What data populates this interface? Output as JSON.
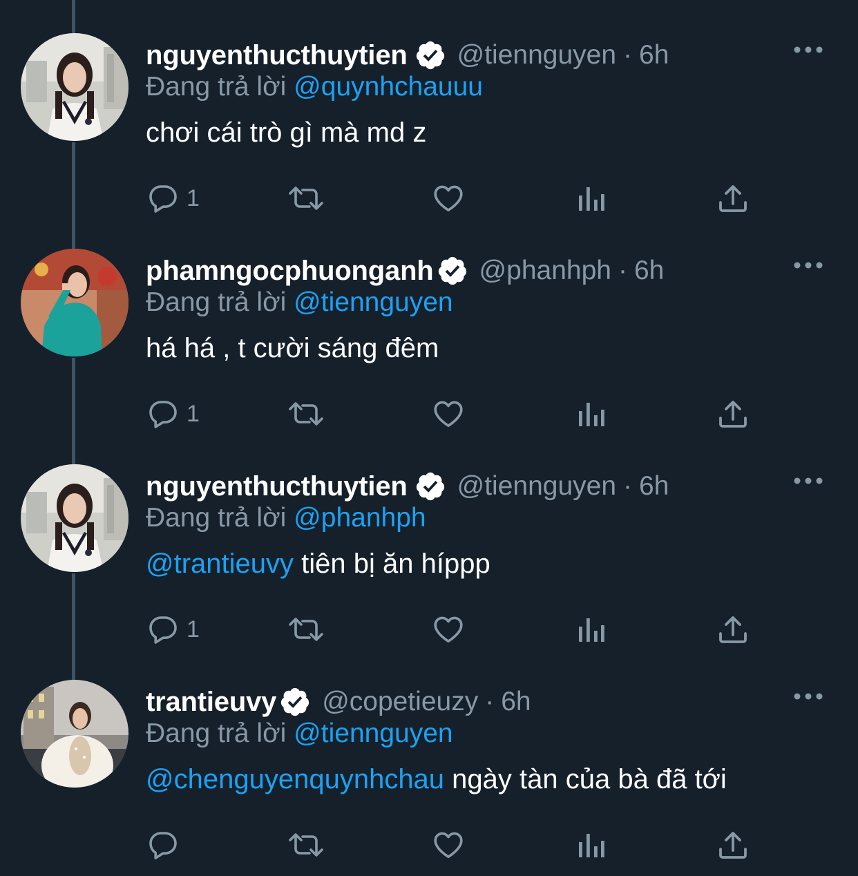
{
  "thread": {
    "tweets": [
      {
        "name": "nguyenthucthuytien",
        "handle": "@tiennguyen",
        "separator": "·",
        "time": "6h",
        "replying_prefix": "Đang trả lời",
        "replying_to": "@quynhchauuu",
        "text_mention": "",
        "text": "chơi cái trò gì mà md z",
        "reply_count": "1",
        "verified": true,
        "avatar": "woman-white-sweater-photo"
      },
      {
        "name": "phamngocphuonganh",
        "handle": "@phanhph",
        "separator": "·",
        "time": "6h",
        "replying_prefix": "Đang trả lời",
        "replying_to": "@tiennguyen",
        "text_mention": "",
        "text": "há há , t cười sáng đêm",
        "reply_count": "1",
        "verified": true,
        "avatar": "woman-teal-dress-photo"
      },
      {
        "name": "nguyenthucthuytien",
        "handle": "@tiennguyen",
        "separator": "·",
        "time": "6h",
        "replying_prefix": "Đang trả lời",
        "replying_to": "@phanhph",
        "text_mention": "@trantieuvy",
        "text": " tiên bị ăn híppp",
        "reply_count": "1",
        "verified": true,
        "avatar": "woman-white-sweater-photo"
      },
      {
        "name": "trantieuvy",
        "handle": "@copetieuzy",
        "separator": "·",
        "time": "6h",
        "replying_prefix": "Đang trả lời",
        "replying_to": "@tiennguyen",
        "text_mention": "@chenguyenquynhchau",
        "text": " ngày tàn của bà đã tới",
        "reply_count": "",
        "verified": true,
        "avatar": "woman-fur-coat-photo"
      }
    ]
  },
  "colors": {
    "background": "#15202b",
    "secondary_text": "#8899a6",
    "accent": "#1da1f2",
    "thread_line": "#3d5466",
    "primary_text": "#ffffff"
  },
  "icons": {
    "reply": "reply-icon",
    "retweet": "retweet-icon",
    "like": "heart-icon",
    "stats": "stats-icon",
    "share": "share-icon",
    "more": "more-icon",
    "verified": "verified-badge-icon"
  }
}
